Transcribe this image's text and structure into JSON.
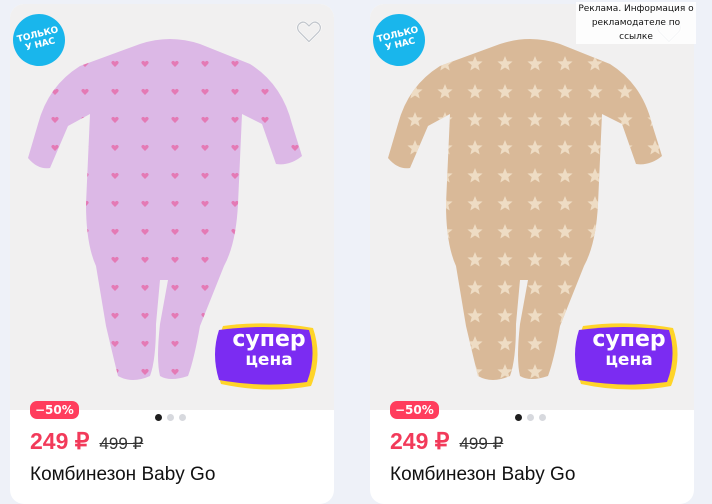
{
  "colors": {
    "discount_bg": "#ff3d5d",
    "price": "#f23a5a",
    "badge_blue": "#19b6ec",
    "super_purple": "#7b2cf2",
    "super_yellow": "#ffd429"
  },
  "ad_note": "Реклама. Информация о рекламодателе по ссылке",
  "products": [
    {
      "badge": "ТОЛЬКО\nУ НАС",
      "promo_line1": "супер",
      "promo_line2": "цена",
      "discount": "−50%",
      "price": "249 ₽",
      "old_price": "499 ₽",
      "title": "Комбинезон Baby Go",
      "garment_color": "#dcb8e6",
      "pattern_color": "#e47ab5",
      "pattern": "hearts",
      "image_count": 3,
      "active_image": 1,
      "fav_icon": "heart-outline-icon"
    },
    {
      "badge": "ТОЛЬКО\nУ НАС",
      "promo_line1": "супер",
      "promo_line2": "цена",
      "discount": "−50%",
      "price": "249 ₽",
      "old_price": "499 ₽",
      "title": "Комбинезон Baby Go",
      "garment_color": "#d9b998",
      "pattern_color": "#eedcc4",
      "pattern": "stars",
      "image_count": 3,
      "active_image": 1,
      "fav_icon": "heart-outline-icon"
    }
  ]
}
